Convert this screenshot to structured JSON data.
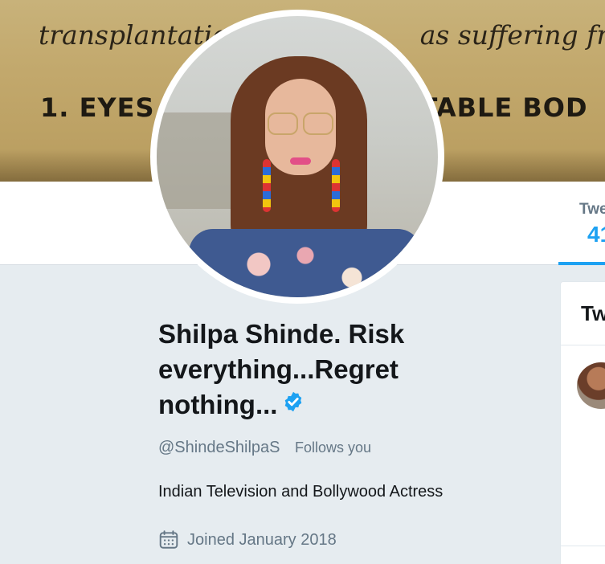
{
  "banner": {
    "line1_left": "transplantatic",
    "line1_right": "as suffering from o",
    "line2_left": "1. EYES",
    "line2_right": "TABLE BOD"
  },
  "nav": {
    "tab_label": "Twe",
    "tab_count": "41"
  },
  "profile": {
    "name": "Shilpa Shinde. Risk everything...Regret nothing...",
    "handle": "@ShindeShilpaS",
    "follows_you": "Follows you",
    "bio": "Indian Television and Bollywood Actress",
    "joined": "Joined January 2018"
  },
  "right_panel": {
    "title": "Tw"
  },
  "colors": {
    "accent": "#1da1f2",
    "secondary_text": "#657786",
    "background": "#e6ecf0"
  },
  "icons": {
    "verified": "verified-badge-icon",
    "calendar": "calendar-icon"
  }
}
